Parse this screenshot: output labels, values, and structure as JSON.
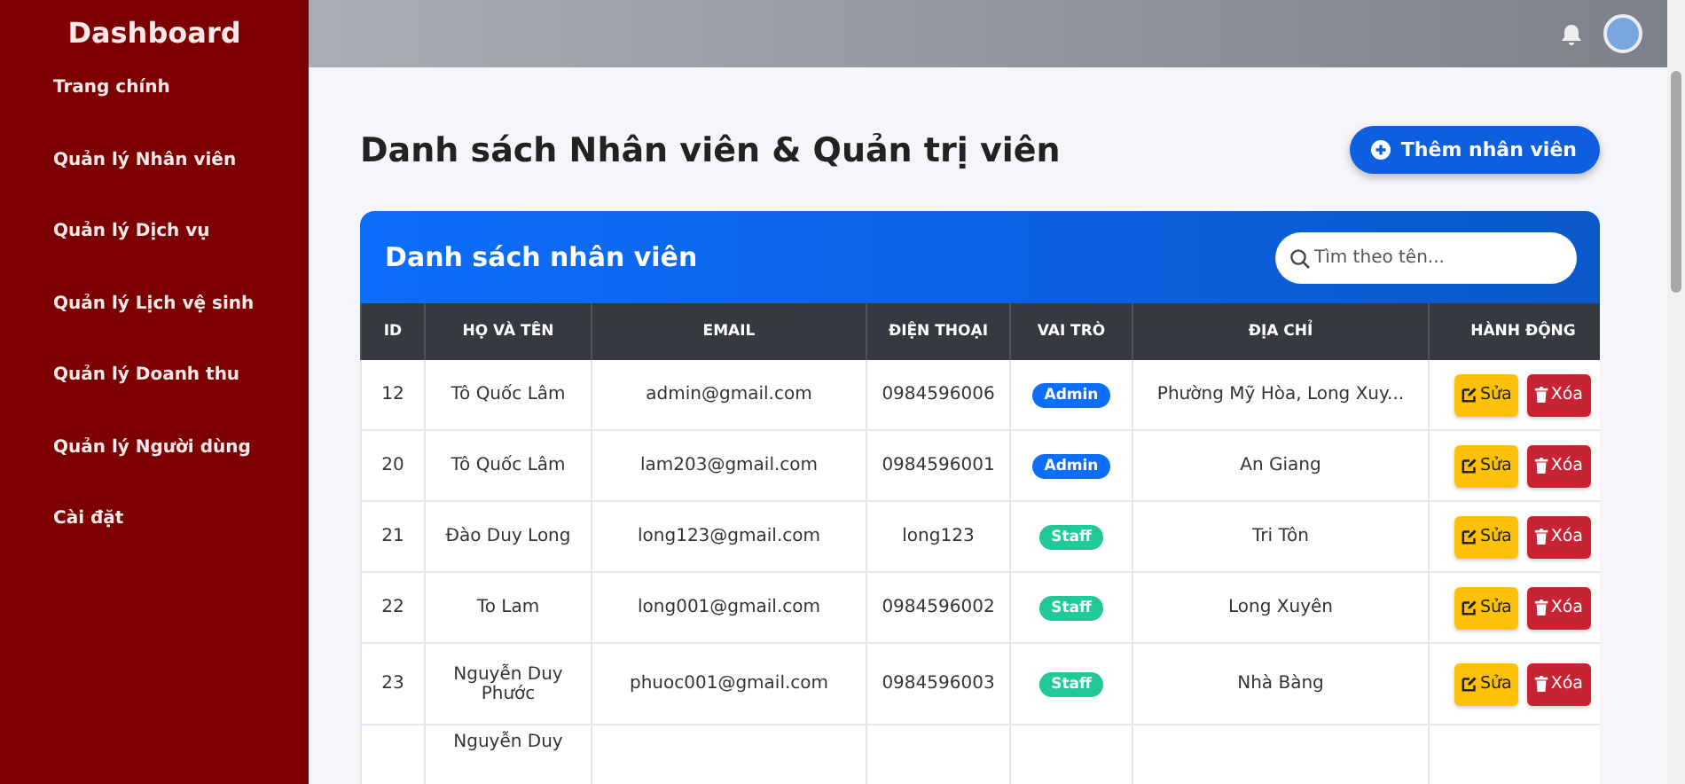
{
  "sidebar": {
    "title": "Dashboard",
    "items": [
      {
        "label": "Trang chính",
        "selected": false
      },
      {
        "label": "Quản lý Nhân viên",
        "selected": false
      },
      {
        "label": "Quản lý Dịch vụ",
        "selected": false
      },
      {
        "label": "Quản lý Lịch vệ sinh",
        "selected": false
      },
      {
        "label": "Quản lý Doanh thu",
        "selected": false
      },
      {
        "label": "Quản lý Người dùng",
        "selected": false
      },
      {
        "label": "Cài đặt",
        "selected": false
      }
    ]
  },
  "page": {
    "title": "Danh sách Nhân viên & Quản trị viên",
    "add_button": "Thêm nhân viên"
  },
  "card": {
    "title": "Danh sách nhân viên",
    "search": {
      "placeholder": "Tìm theo tên..."
    }
  },
  "table": {
    "columns": [
      "ID",
      "HỌ VÀ TÊN",
      "EMAIL",
      "ĐIỆN THOẠI",
      "VAI TRÒ",
      "ĐỊA CHỈ",
      "HÀNH ĐỘNG"
    ],
    "rows": [
      {
        "id": "12",
        "name": "Tô Quốc Lâm",
        "email": "admin@gmail.com",
        "phone": "0984596006",
        "role": "Admin",
        "color": "#0d6efd",
        "address": "Phường Mỹ Hòa, Long Xuy...",
        "actions": [
          "Sửa",
          "Xóa"
        ]
      },
      {
        "id": "20",
        "name": "Tô Quốc Lâm",
        "email": "lam203@gmail.com",
        "phone": "0984596001",
        "role": "Admin",
        "color": "#0d6efd",
        "address": "An Giang",
        "actions": [
          "Sửa",
          "Xóa"
        ]
      },
      {
        "id": "21",
        "name": "Đào Duy Long",
        "email": "long123@gmail.com",
        "phone": "long123",
        "role": "Staff",
        "color": "#20c997",
        "address": "Tri Tôn",
        "actions": [
          "Sửa",
          "Xóa"
        ]
      },
      {
        "id": "22",
        "name": "To Lam",
        "email": "long001@gmail.com",
        "phone": "0984596002",
        "role": "Staff",
        "color": "#20c997",
        "address": "Long Xuyên",
        "actions": [
          "Sửa",
          "Xóa"
        ]
      },
      {
        "id": "23",
        "name": "Nguyễn Duy Phước",
        "email": "phuoc001@gmail.com",
        "phone": "0984596003",
        "role": "Staff",
        "color": "#20c997",
        "address": "Nhà Bàng",
        "actions": [
          "Sửa",
          "Xóa"
        ]
      },
      {
        "name": "Nguyễn Duy"
      }
    ]
  }
}
